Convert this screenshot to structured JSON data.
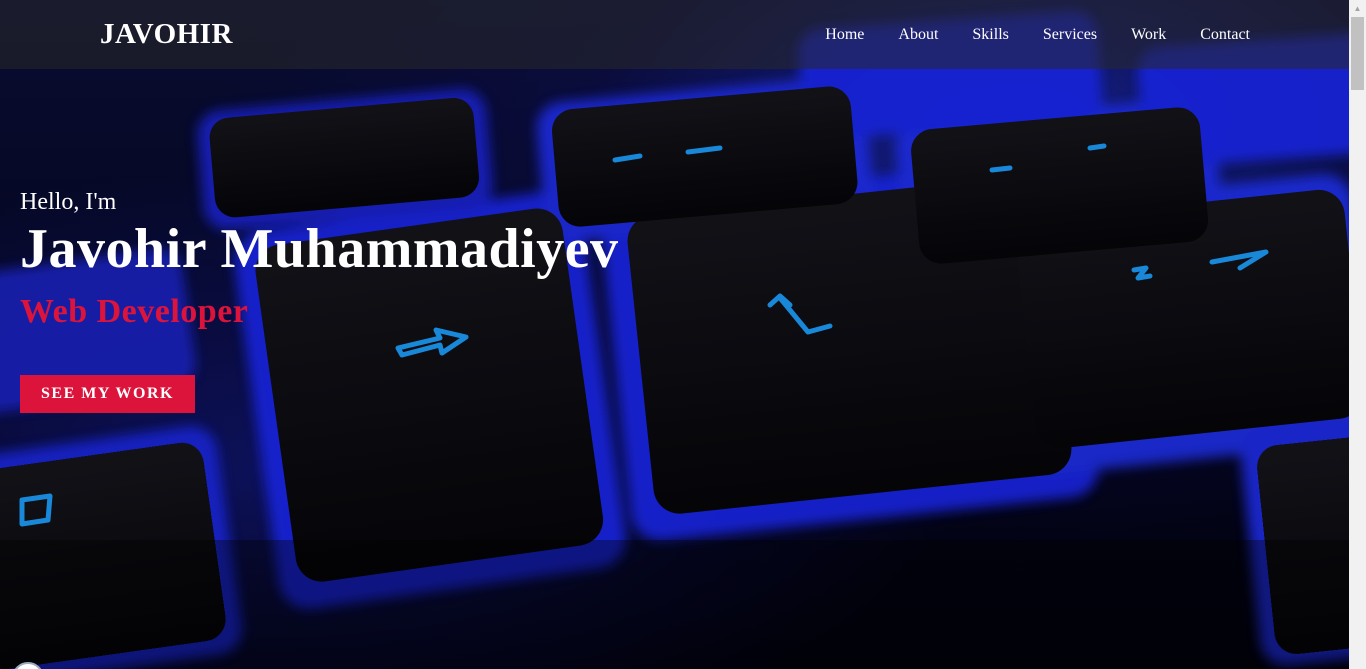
{
  "navbar": {
    "logo": "JAVOHIR",
    "links": [
      {
        "label": "Home"
      },
      {
        "label": "About"
      },
      {
        "label": "Skills"
      },
      {
        "label": "Services"
      },
      {
        "label": "Work"
      },
      {
        "label": "Contact"
      }
    ]
  },
  "hero": {
    "greeting": "Hello, I'm",
    "name": "Javohir Muhammadiyev",
    "role": "Web Developer",
    "cta_label": "SEE MY WORK",
    "background_image": "blue-backlit-keyboard"
  },
  "colors": {
    "accent": "#dc143c",
    "nav_bg": "rgba(40,40,40,0.55)",
    "text": "#ffffff"
  }
}
